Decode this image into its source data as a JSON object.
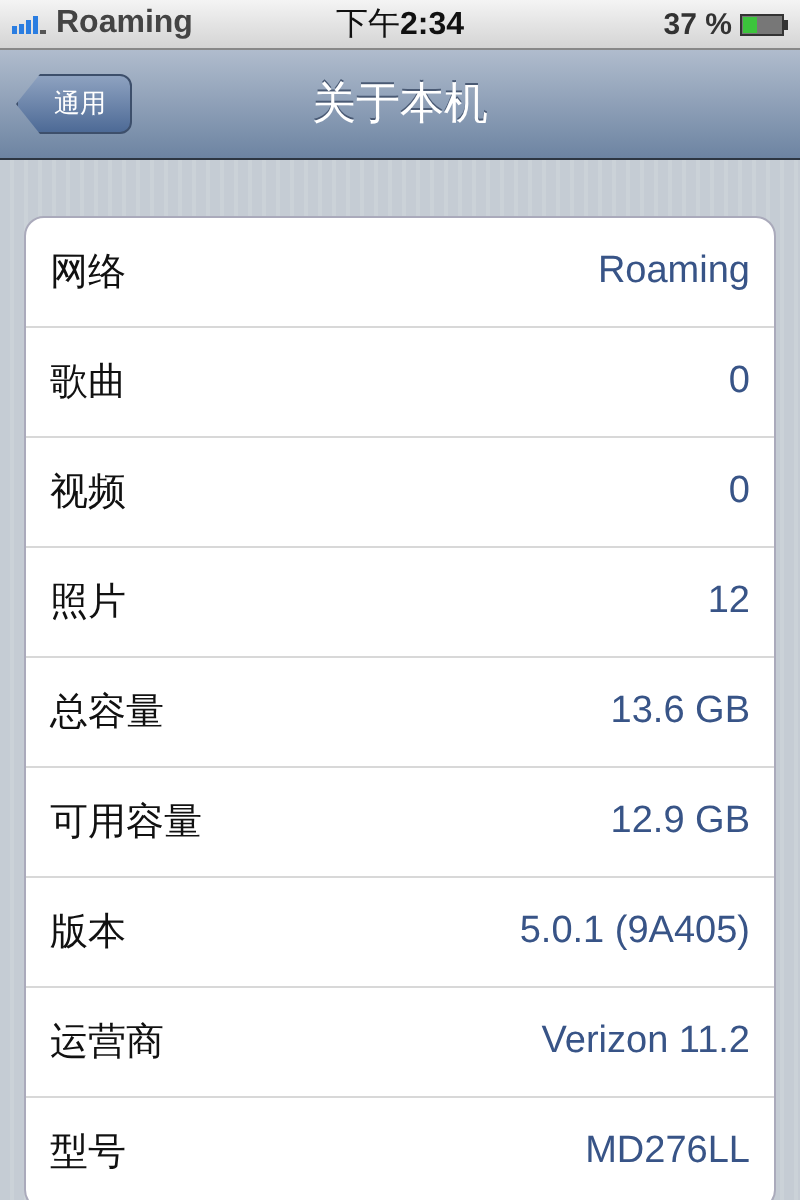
{
  "status_bar": {
    "carrier": "Roaming",
    "time_prefix": "下午",
    "time": "2:34",
    "battery": "37 %"
  },
  "nav_bar": {
    "back": "通用",
    "title": "关于本机"
  },
  "rows": [
    {
      "label": "网络",
      "value": "Roaming"
    },
    {
      "label": "歌曲",
      "value": "0"
    },
    {
      "label": "视频",
      "value": "0"
    },
    {
      "label": "照片",
      "value": "12"
    },
    {
      "label": "总容量",
      "value": "13.6 GB"
    },
    {
      "label": "可用容量",
      "value": "12.9 GB"
    },
    {
      "label": "版本",
      "value": "5.0.1 (9A405)"
    },
    {
      "label": "运营商",
      "value": "Verizon 11.2"
    },
    {
      "label": "型号",
      "value": "MD276LL"
    }
  ]
}
